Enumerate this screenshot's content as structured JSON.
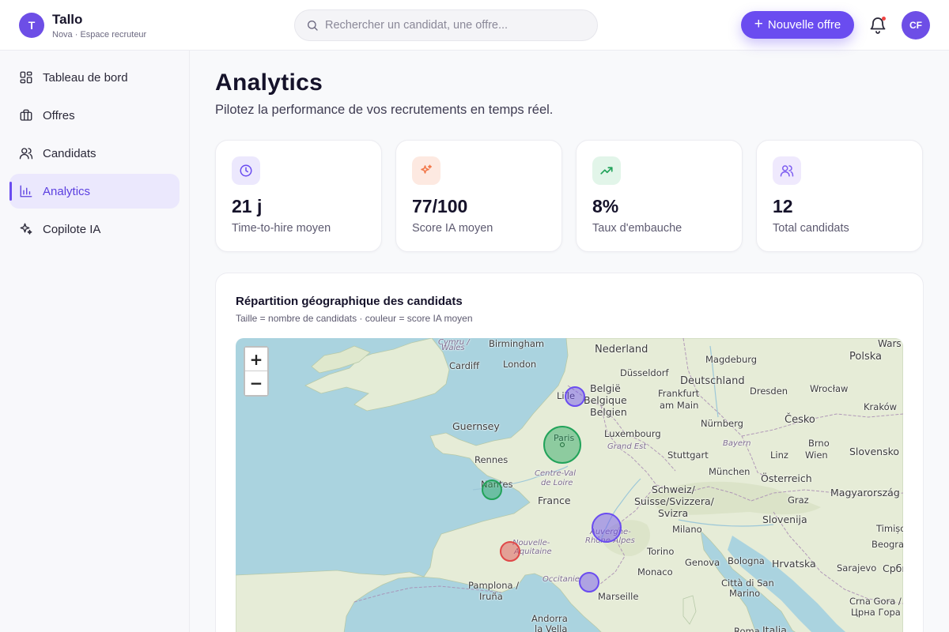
{
  "brand": {
    "initial": "T",
    "name": "Tallo",
    "subtitle": "Nova · Espace recruteur"
  },
  "search": {
    "placeholder": "Rechercher un candidat, une offre..."
  },
  "header": {
    "new_offer_label": "Nouvelle offre",
    "avatar_initials": "CF"
  },
  "sidebar": {
    "items": [
      {
        "label": "Tableau de bord",
        "icon": "dashboard-icon"
      },
      {
        "label": "Offres",
        "icon": "briefcase-icon"
      },
      {
        "label": "Candidats",
        "icon": "users-icon"
      },
      {
        "label": "Analytics",
        "icon": "bar-chart-icon",
        "active": true
      },
      {
        "label": "Copilote IA",
        "icon": "sparkles-icon"
      }
    ]
  },
  "page": {
    "title": "Analytics",
    "subtitle": "Pilotez la performance de vos recrutements en temps réel."
  },
  "kpis": [
    {
      "value": "21 j",
      "label": "Time-to-hire moyen",
      "icon": "clock-icon",
      "color": "#6a4cf0"
    },
    {
      "value": "77/100",
      "label": "Score IA moyen",
      "icon": "sparkles-icon",
      "color": "#f2784b"
    },
    {
      "value": "8%",
      "label": "Taux d'embauche",
      "icon": "trending-up-icon",
      "color": "#22a35a"
    },
    {
      "value": "12",
      "label": "Total candidats",
      "icon": "users-icon",
      "color": "#7c5cf0"
    }
  ],
  "map_card": {
    "title": "Répartition géographique des candidats",
    "subtitle": "Taille = nombre de candidats · couleur = score IA moyen",
    "zoom_in": "+",
    "zoom_out": "−",
    "labels": {
      "cymru": "Cymru /",
      "wales": "Wales",
      "birmingham": "Birmingham",
      "nederland": "Nederland",
      "magdeburg": "Magdeburg",
      "warszawa": "Wars",
      "cardiff": "Cardiff",
      "london": "London",
      "dusseldorf": "Düsseldorf",
      "deutschland": "Deutschland",
      "polska": "Polska",
      "lille": "Lille",
      "belgie": "België",
      "belgique": "Belgique",
      "belgien": "Belgien",
      "frankfurt": "Frankfurt",
      "ammain": "am Main",
      "dresden": "Dresden",
      "wroclaw": "Wrocław",
      "krakow": "Kraków",
      "guernsey": "Guernsey",
      "paris": "Paris",
      "luxembourg": "Luxembourg",
      "nurnberg": "Nürnberg",
      "cesko": "Česko",
      "grandest": "Grand Est",
      "bayern": "Bayern",
      "brno": "Brno",
      "rennes": "Rennes",
      "stuttgart": "Stuttgart",
      "linz": "Linz",
      "wien": "Wien",
      "slovensko": "Slovensko",
      "centreval": "Centre-Val",
      "deloire": "de Loire",
      "munchen": "München",
      "osterreich": "Österreich",
      "nantes": "Nantes",
      "france": "France",
      "schweiz": "Schweiz/",
      "suisse": "Suisse/Svizzera/",
      "svizra": "Svizra",
      "graz": "Graz",
      "magyar": "Magyarország",
      "slovenija": "Slovenija",
      "auvergne": "Auvergne-",
      "rhonealpes": "Rhône-Alpes",
      "milano": "Milano",
      "timisoara": "Timișoara",
      "nouvelle": "Nouvelle-",
      "aquitaine": "Aquitaine",
      "torino": "Torino",
      "beograd": "Beograd",
      "genova": "Genova",
      "bologna": "Bologna",
      "hrvatska": "Hrvatska",
      "monaco": "Monaco",
      "occitanie": "Occitanie",
      "sarajevo": "Sarajevo",
      "srbija": "Србиј",
      "pamplona": "Pamplona /",
      "irunea": "Iruña",
      "marseille": "Marseille",
      "citta": "Città di San",
      "marino": "Marino",
      "crnagora": "Crna Gora /",
      "crnagora2": "Црна Гора",
      "andorra": "Andorra",
      "lavella": "la Vella",
      "roma": "Roma",
      "italia": "Italia"
    }
  },
  "markers": [
    {
      "city": "Paris",
      "color": "#22a35a"
    },
    {
      "city": "Lille",
      "color": "#6a4cf0"
    },
    {
      "city": "Nantes",
      "color": "#22a35a"
    },
    {
      "city": "Lyon",
      "color": "#6a4cf0"
    },
    {
      "city": "Bordeaux",
      "color": "#e04848"
    },
    {
      "city": "Montpellier",
      "color": "#6a4cf0"
    }
  ]
}
